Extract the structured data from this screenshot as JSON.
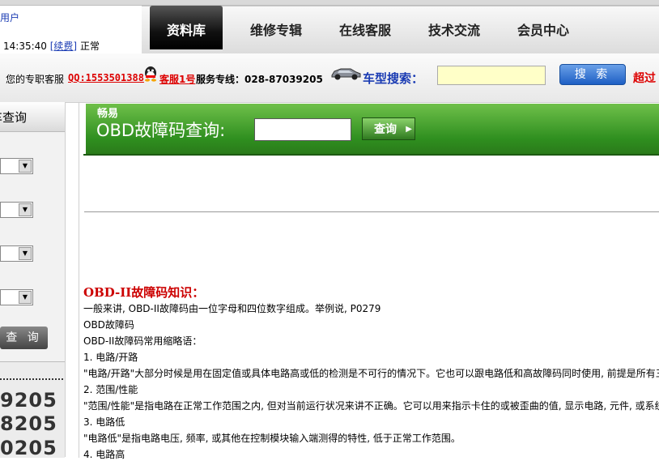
{
  "header": {
    "user_label": "用户",
    "time": "14:35:40",
    "renew": "[续费]",
    "status": "正常",
    "nav": [
      "资料库",
      "维修专辑",
      "在线客服",
      "技术交流",
      "会员中心"
    ]
  },
  "service_bar": {
    "label": "您的专职客服",
    "qq": "QQ:1553501388",
    "kefu": "客服1号",
    "hotline": "服务专线：028-87039205",
    "car_search_label": "车型搜索：",
    "car_search_value": "",
    "search_button": "搜 索",
    "exceed": "超过"
  },
  "sidebar": {
    "title": "车查询",
    "query_button": "查 询",
    "numbers": [
      "9205",
      "8205",
      "0205"
    ]
  },
  "obd": {
    "brand": "畅易",
    "label": "OBD故障码查询:",
    "input_value": "",
    "button": "查询"
  },
  "knowledge": {
    "title": "OBD-II故障码知识：",
    "lines": [
      "一般来讲, OBD-II故障码由一位字母和四位数字组成。举例说, P0279",
      "OBD故障码",
      "OBD-II故障码常用缩略语：",
      "1. 电路/开路",
      "\"电路/开路\"大部分时候是用在固定值或具体电路高或低的检测是不可行的情况下。它也可以跟电路低和高故障码同时使用, 前提是所有三",
      "2. 范围/性能",
      "\"范围/性能\"是指电路在正常工作范围之内, 但对当前运行状况来讲不正确。它可以用来指示卡住的或被歪曲的值, 显示电路, 元件, 或系统",
      "3. 电路低",
      "\"电路低\"是指电路电压, 频率, 或其他在控制模块输入端测得的特性, 低于正常工作范围。",
      "4. 电路高"
    ]
  }
}
